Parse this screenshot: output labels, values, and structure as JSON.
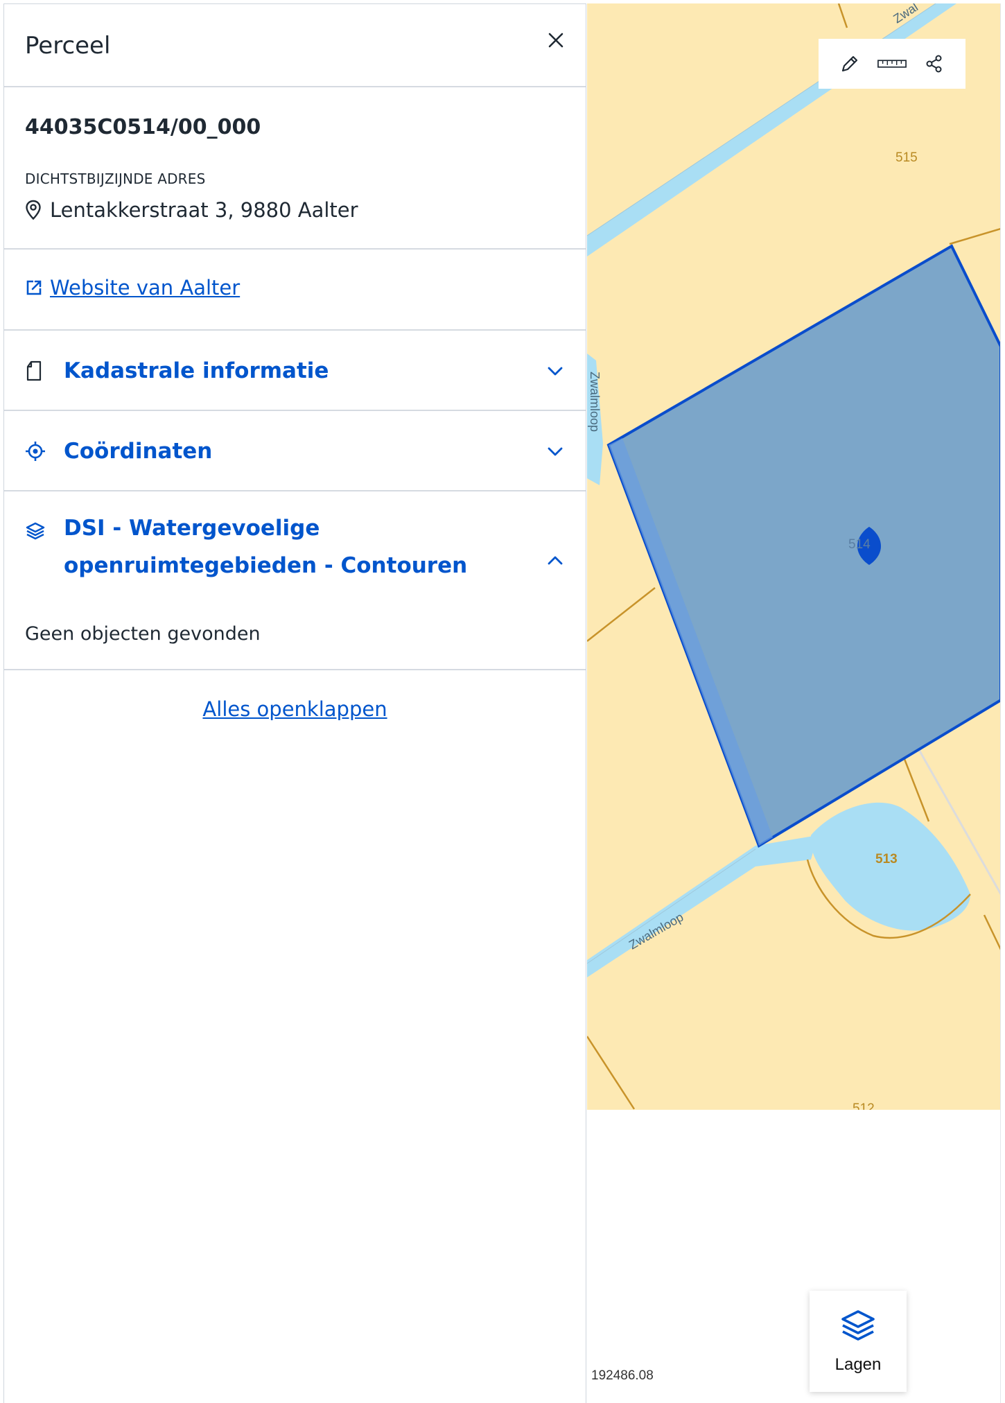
{
  "panel": {
    "title": "Perceel",
    "parcel_id": "44035C0514/00_000",
    "address_label": "DICHTSTBIJZIJNDE ADRES",
    "address": "Lentakkerstraat 3, 9880 Aalter",
    "website_link": "Website van Aalter",
    "sections": [
      {
        "label": "Kadastrale informatie",
        "icon": "document-icon",
        "expanded": false
      },
      {
        "label": "Coördinaten",
        "icon": "location-target-icon",
        "expanded": false
      },
      {
        "label_line1": "DSI - Watergevoelige",
        "label_line2": "openruimtegebieden - Contouren",
        "icon": "layers-icon",
        "expanded": true,
        "body": "Geen objecten gevonden"
      }
    ],
    "expand_all": "Alles openklappen"
  },
  "map": {
    "parcel_labels": [
      "515",
      "514",
      "513",
      "512"
    ],
    "street_labels": [
      "Zwalmloop",
      "Zwalmloop",
      "Zwal"
    ],
    "scale_value": "192486.08",
    "layers_button": "Lagen",
    "colors": {
      "land": "#fde9b3",
      "water": "#a9def4",
      "parcel_fill": "#7ca6c9",
      "parcel_border": "#0a4dcc",
      "boundary": "#c8932a",
      "accent": "#0055cc"
    }
  }
}
